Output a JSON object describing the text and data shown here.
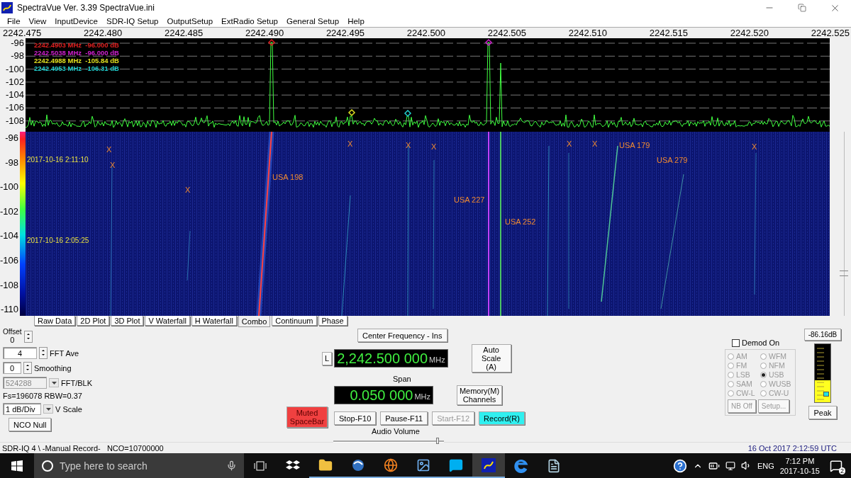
{
  "window": {
    "title": "SpectraVue Ver. 3.39  SpectraVue.ini"
  },
  "menu": [
    "File",
    "View",
    "InputDevice",
    "SDR-IQ Setup",
    "OutputSetup",
    "ExtRadio Setup",
    "General Setup",
    "Help"
  ],
  "freq_axis": [
    "2242.475",
    "2242.480",
    "2242.485",
    "2242.490",
    "2242.495",
    "2242.500",
    "2242.505",
    "2242.510",
    "2242.515",
    "2242.520",
    "2242.525"
  ],
  "spectrum": {
    "db_labels": [
      "-96",
      "-98",
      "-100",
      "-102",
      "-104",
      "-106",
      "-108"
    ],
    "markers": [
      {
        "frequency": "2242.4903 MHz",
        "reading": "-96.000 dB",
        "color": "#e02020"
      },
      {
        "frequency": "2242.5038 MHz",
        "reading": "-96.000 dB",
        "color": "#d020d0"
      },
      {
        "frequency": "2242.4988 MHz",
        "reading": "-105.84 dB",
        "color": "#e0e020"
      },
      {
        "frequency": "2242.4953 MHz",
        "reading": "-106.31 dB",
        "color": "#20d0d0"
      }
    ]
  },
  "waterfall": {
    "db_labels": [
      "-96",
      "-98",
      "-100",
      "-102",
      "-104",
      "-106",
      "-108",
      "-110"
    ],
    "timestamps": [
      "2017-10-16 2:11:10",
      "2017-10-16 2:05:25"
    ],
    "x_marks": [
      "X",
      "X",
      "X",
      "X",
      "X",
      "X",
      "X",
      "X",
      "X"
    ],
    "satellites": [
      "USA 198",
      "USA 227",
      "USA 252",
      "USA 179",
      "USA 279"
    ]
  },
  "side_slider": {
    "level": 0.23
  },
  "tabs": [
    {
      "label": "Raw Data",
      "selected": false
    },
    {
      "label": "2D Plot",
      "selected": false
    },
    {
      "label": "3D Plot",
      "selected": false
    },
    {
      "label": "V Waterfall",
      "selected": false
    },
    {
      "label": "H Waterfall",
      "selected": false
    },
    {
      "label": "Combo",
      "selected": true
    },
    {
      "label": "Continuum",
      "selected": false
    },
    {
      "label": "Phase",
      "selected": false
    }
  ],
  "controls": {
    "offset": {
      "label": "Offset",
      "value": "0"
    },
    "fft_ave": {
      "label": "FFT Ave",
      "value": "4"
    },
    "smoothing": {
      "label": "Smoothing",
      "value": "0"
    },
    "fft_blk": {
      "label": "FFT/BLK",
      "value": "524288",
      "disabled": true
    },
    "info": "Fs=196078 RBW=0.37",
    "v_scale": {
      "label": "V Scale",
      "value": "1 dB/Div"
    },
    "nco_null": "NCO Null",
    "mute": {
      "label": "Muted SpaceBar",
      "on": true
    }
  },
  "center": {
    "title_button": "Center Frequency - Ins",
    "l_button": "L",
    "frequency": "2,242.500 000",
    "unit": "MHz",
    "auto_scale": "Auto Scale (A)",
    "span_label": "Span",
    "span": "0.050 000",
    "span_unit": "MHz",
    "memory": "Memory(M) Channels"
  },
  "transport": [
    {
      "label": "Stop-F10",
      "disabled": false,
      "active": false
    },
    {
      "label": "Pause-F11",
      "disabled": false,
      "active": false
    },
    {
      "label": "Start-F12",
      "disabled": true,
      "active": false
    },
    {
      "label": "Record(R)",
      "disabled": false,
      "active": true
    }
  ],
  "audio": {
    "label": "Audio Volume",
    "level": 0.94
  },
  "demod": {
    "label": "Demod On",
    "checked": false,
    "disabled": true,
    "modes": [
      {
        "label": "AM",
        "selected": false
      },
      {
        "label": "WFM",
        "selected": false
      },
      {
        "label": "FM",
        "selected": false
      },
      {
        "label": "NFM",
        "selected": false
      },
      {
        "label": "LSB",
        "selected": false
      },
      {
        "label": "USB",
        "selected": true
      },
      {
        "label": "SAM",
        "selected": false
      },
      {
        "label": "WUSB",
        "selected": false
      },
      {
        "label": "CW-L",
        "selected": false
      },
      {
        "label": "CW-U",
        "selected": false
      }
    ],
    "buttons": [
      "NB Off",
      "Setup..."
    ]
  },
  "meter": {
    "reading": "-86.16dB",
    "level": 0.38,
    "peak": "Peak"
  },
  "status_bar": {
    "left": "SDR-IQ 4 \\ -Manual Record-   NCO=10700000",
    "right": "16 Oct 2017  2:12:59 UTC"
  },
  "taskbar": {
    "search_placeholder": "Type here to search",
    "language": "ENG",
    "time": "7:12 PM",
    "date": "2017-10-15",
    "notifications": "2"
  }
}
